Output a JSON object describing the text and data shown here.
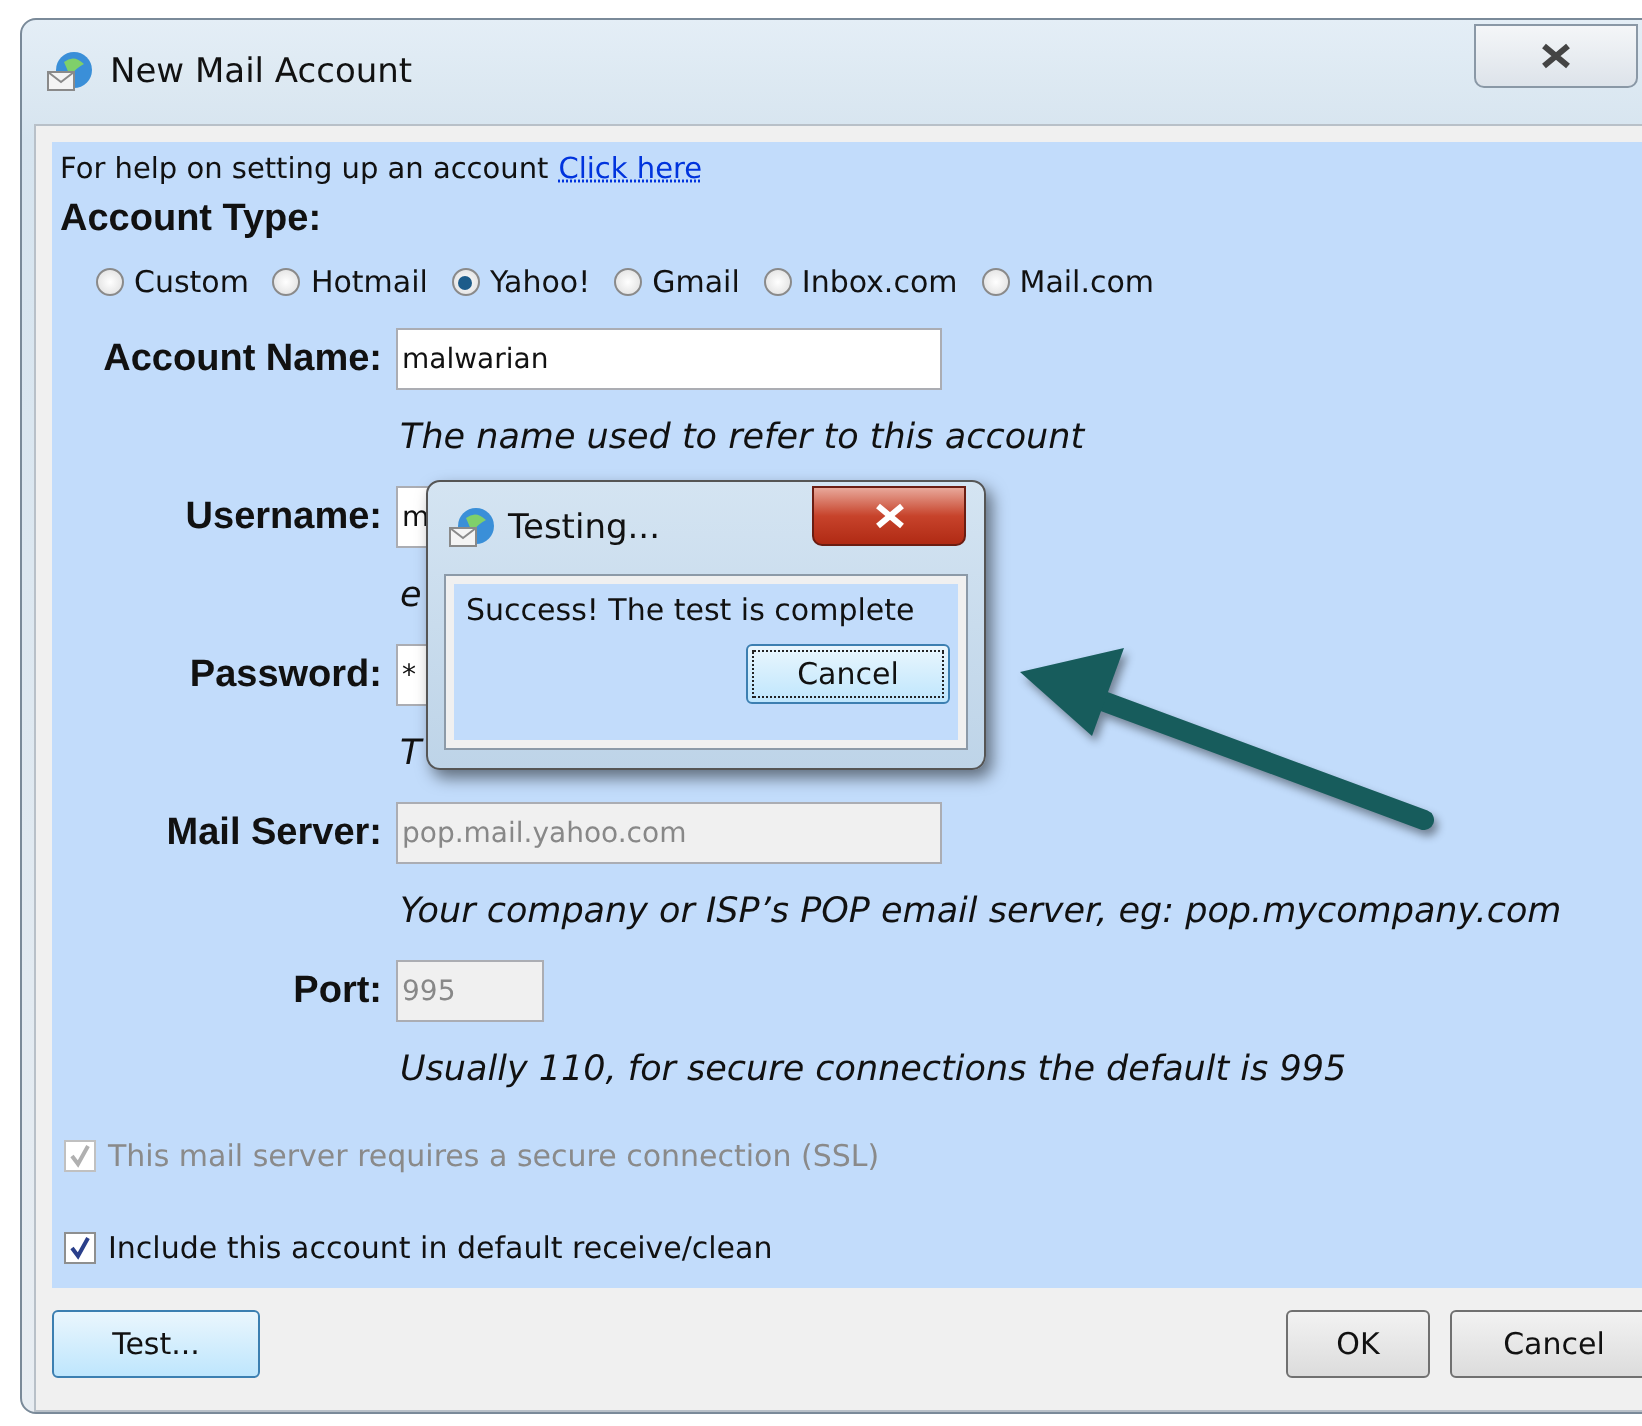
{
  "window": {
    "title": "New Mail Account"
  },
  "help": {
    "text": "For help on setting up an account",
    "link": "Click here"
  },
  "account_type": {
    "label": "Account Type:",
    "options": [
      {
        "label": "Custom",
        "selected": false
      },
      {
        "label": "Hotmail",
        "selected": false
      },
      {
        "label": "Yahoo!",
        "selected": true
      },
      {
        "label": "Gmail",
        "selected": false
      },
      {
        "label": "Inbox.com",
        "selected": false
      },
      {
        "label": "Mail.com",
        "selected": false
      }
    ]
  },
  "fields": [
    {
      "label": "Account Name:",
      "value": "malwarian",
      "hint": "The name used to refer to this account",
      "disabled": false,
      "kind": "wide"
    },
    {
      "label": "Username:",
      "value": "m",
      "hint": "e",
      "disabled": false,
      "kind": "wide"
    },
    {
      "label": "Password:",
      "value": "*",
      "hint": "T",
      "disabled": false,
      "kind": "wide"
    },
    {
      "label": "Mail Server:",
      "value": "pop.mail.yahoo.com",
      "hint": "Your company or ISP’s POP email server, eg: pop.mycompany.com",
      "disabled": true,
      "kind": "wide"
    },
    {
      "label": "Port:",
      "value": "995",
      "hint": "Usually 110, for secure connections the default is 995",
      "disabled": true,
      "kind": "short"
    }
  ],
  "checkboxes": [
    {
      "label": "This mail server requires a secure connection (SSL)",
      "checked": true,
      "disabled": true
    },
    {
      "label": "Include this account in default receive/clean",
      "checked": true,
      "disabled": false
    }
  ],
  "buttons": [
    {
      "label": "Test...",
      "kind": "left"
    },
    {
      "label": "OK",
      "kind": "right"
    },
    {
      "label": "Cancel",
      "kind": "right"
    }
  ],
  "popup": {
    "title": "Testing...",
    "message": "Success! The test is complete",
    "button": "Cancel"
  }
}
